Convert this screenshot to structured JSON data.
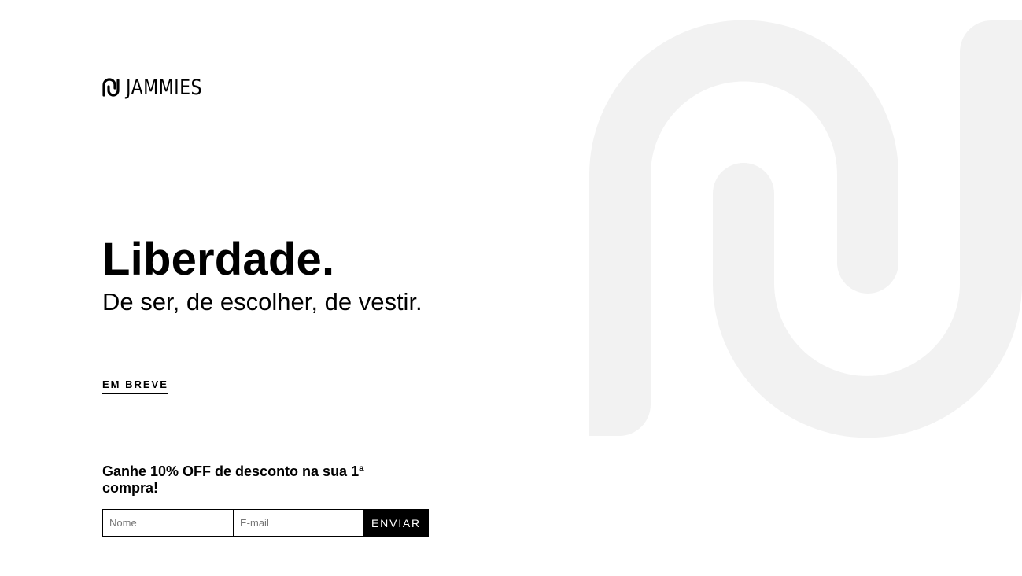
{
  "brand": {
    "name": "JAMMIES",
    "logo_icon": "jammies-mark-icon",
    "mark_color": "#f2f2f2"
  },
  "hero": {
    "title": "Liberdade.",
    "subtitle": "De ser, de escolher, de vestir."
  },
  "status": {
    "label": "EM BREVE"
  },
  "newsletter": {
    "promo_text": "Ganhe 10% OFF de desconto na sua 1ª compra!",
    "name_placeholder": "Nome",
    "email_placeholder": "E-mail",
    "submit_label": "ENVIAR"
  }
}
